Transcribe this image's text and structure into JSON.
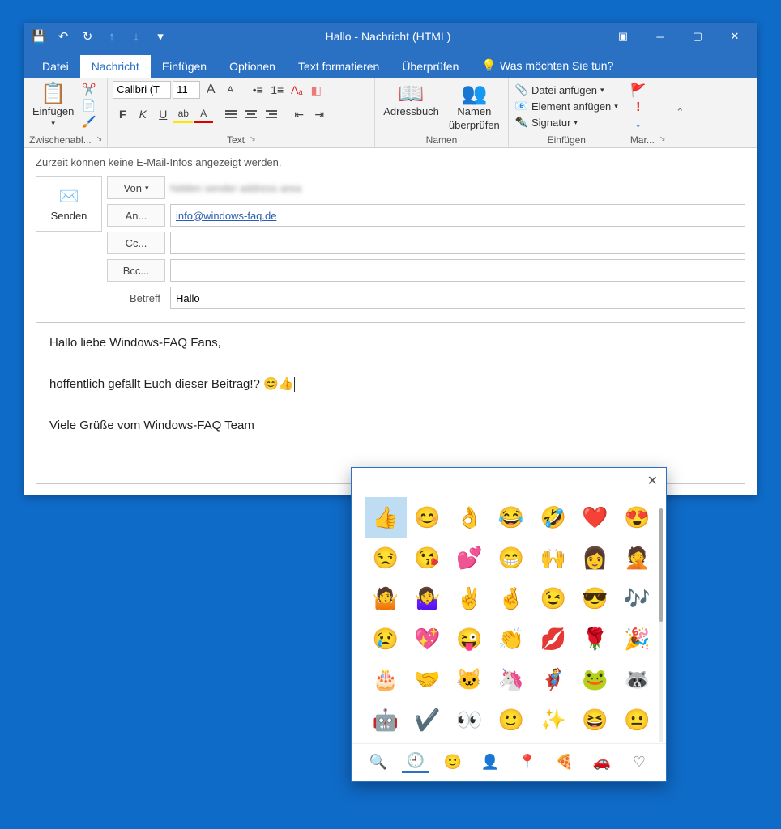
{
  "titlebar": {
    "title": "Hallo  -  Nachricht (HTML)"
  },
  "tabs": {
    "file": "Datei",
    "message": "Nachricht",
    "insert": "Einfügen",
    "options": "Optionen",
    "format": "Text formatieren",
    "review": "Überprüfen",
    "tellme": "Was möchten Sie tun?"
  },
  "ribbon": {
    "clipboard": {
      "paste": "Einfügen",
      "group": "Zwischenabl..."
    },
    "font": {
      "name": "Calibri (T",
      "size": "11",
      "group": "Text"
    },
    "names": {
      "addressbook": "Adressbuch",
      "checknames_l1": "Namen",
      "checknames_l2": "überprüfen",
      "group": "Namen"
    },
    "include": {
      "attachfile": "Datei anfügen",
      "attachitem": "Element anfügen",
      "signature": "Signatur",
      "group": "Einfügen"
    },
    "tags": {
      "group": "Mar..."
    }
  },
  "infobar": "Zurzeit können keine E-Mail-Infos angezeigt werden.",
  "compose": {
    "send": "Senden",
    "from_label": "Von",
    "to_label": "An...",
    "cc_label": "Cc...",
    "bcc_label": "Bcc...",
    "subject_label": "Betreff",
    "to_value": "info@windows-faq.de",
    "cc_value": "",
    "bcc_value": "",
    "subject_value": "Hallo",
    "body_line1": "Hallo liebe Windows-FAQ Fans,",
    "body_line2": "hoffentlich gefällt Euch dieser Beitrag!? 😊👍",
    "body_line3": "Viele Grüße vom Windows-FAQ Team"
  },
  "emoji": {
    "grid": [
      "👍",
      "😊",
      "👌",
      "😂",
      "🤣",
      "❤️",
      "😍",
      "😒",
      "😘",
      "💕",
      "😁",
      "🙌",
      "👩",
      "🤦",
      "🤷",
      "🤷‍♀️",
      "✌️",
      "🤞",
      "😉",
      "😎",
      "🎶",
      "😢",
      "💖",
      "😜",
      "👏",
      "💋",
      "🌹",
      "🎉",
      "🎂",
      "🤝",
      "🐱",
      "🦄",
      "🦸",
      "🐸",
      "🦝",
      "🤖",
      "✔️",
      "👀",
      "🙂",
      "✨",
      "😆",
      "😐"
    ],
    "tabs": [
      "🔍",
      "🕘",
      "🙂",
      "👤",
      "📍",
      "🍕",
      "🚗",
      "♡"
    ]
  }
}
